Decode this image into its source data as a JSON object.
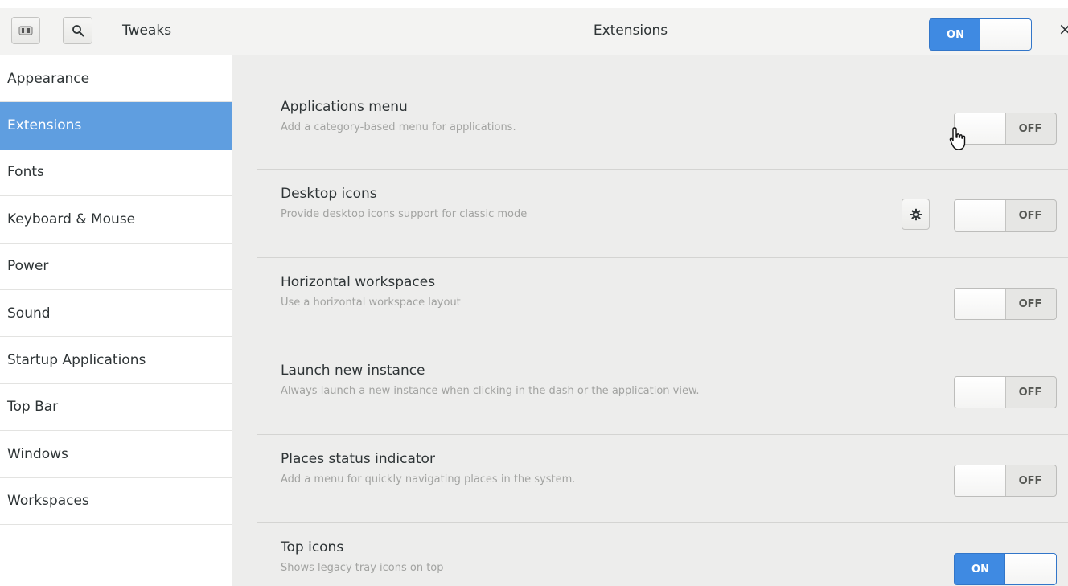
{
  "app": {
    "title": "Tweaks",
    "page_title": "Extensions",
    "global_switch": "ON",
    "close_glyph": "×",
    "app_icon": "app-menu-icon",
    "search_icon": "search-icon"
  },
  "sidebar": {
    "items": [
      {
        "label": "Appearance",
        "active": false
      },
      {
        "label": "Extensions",
        "active": true
      },
      {
        "label": "Fonts",
        "active": false
      },
      {
        "label": "Keyboard & Mouse",
        "active": false
      },
      {
        "label": "Power",
        "active": false
      },
      {
        "label": "Sound",
        "active": false
      },
      {
        "label": "Startup Applications",
        "active": false
      },
      {
        "label": "Top Bar",
        "active": false
      },
      {
        "label": "Windows",
        "active": false
      },
      {
        "label": "Workspaces",
        "active": false
      }
    ]
  },
  "extensions": [
    {
      "title": "Applications menu",
      "description": "Add a category-based menu for applications.",
      "state": "OFF",
      "has_settings": false
    },
    {
      "title": "Desktop icons",
      "description": "Provide desktop icons support for classic mode",
      "state": "OFF",
      "has_settings": true
    },
    {
      "title": "Horizontal workspaces",
      "description": "Use a horizontal workspace layout",
      "state": "OFF",
      "has_settings": false
    },
    {
      "title": "Launch new instance",
      "description": "Always launch a new instance when clicking in the dash or the application view.",
      "state": "OFF",
      "has_settings": false
    },
    {
      "title": "Places status indicator",
      "description": "Add a menu for quickly navigating places in the system.",
      "state": "OFF",
      "has_settings": false
    },
    {
      "title": "Top icons",
      "description": "Shows legacy tray icons on top",
      "state": "ON",
      "has_settings": false
    }
  ],
  "colors": {
    "accent": "#5f9ee0",
    "switch_on": "#3f8ae2",
    "background": "#ededec"
  }
}
